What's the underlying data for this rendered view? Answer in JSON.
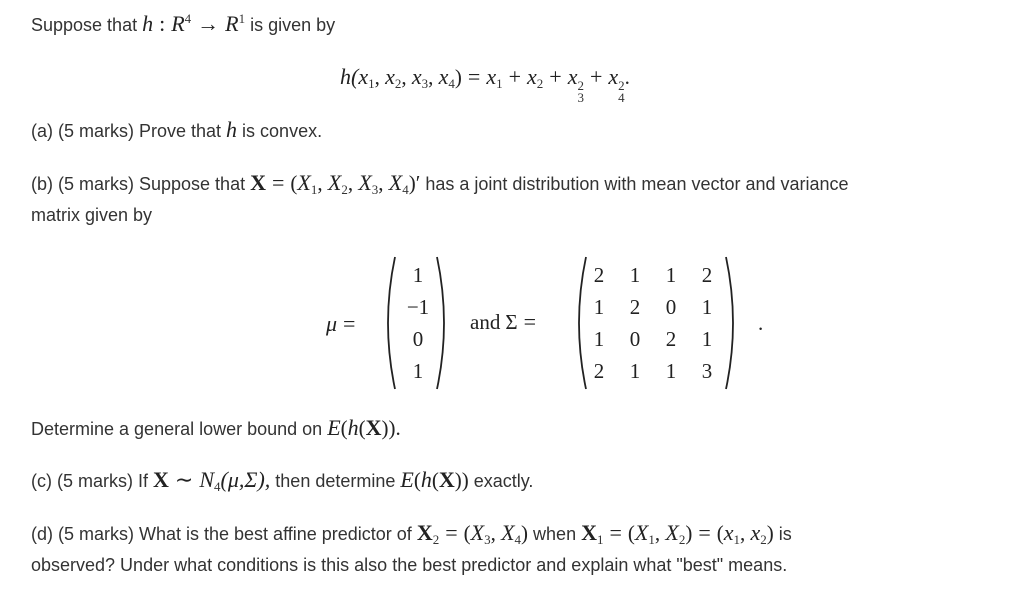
{
  "intro": {
    "text_before": "Suppose that ",
    "func": "h",
    "colon": ":",
    "domain": "R",
    "domain_exp": "4",
    "arrow": "→",
    "codomain": "R",
    "codomain_exp": "1",
    "text_after": " is given by"
  },
  "definition": {
    "lhs": "h(",
    "args": [
      "x",
      "x",
      "x",
      "x"
    ],
    "arg_subs": [
      "1",
      "2",
      "3",
      "4"
    ],
    "equals": "=",
    "rhs_terms": [
      {
        "var": "x",
        "sub": "1",
        "sup": ""
      },
      {
        "var": "x",
        "sub": "2",
        "sup": ""
      },
      {
        "var": "x",
        "sub": "3",
        "sup": "2"
      },
      {
        "var": "x",
        "sub": "4",
        "sup": "2"
      }
    ],
    "plus": "+",
    "end": "."
  },
  "part_a": {
    "label": "(a) (5 marks) Prove that ",
    "func": "h",
    "text_after": " is convex."
  },
  "part_b": {
    "label": "(b) (5 marks) Suppose that ",
    "vec": "X",
    "equals": "=",
    "tuple_vars": [
      "X",
      "X",
      "X",
      "X"
    ],
    "tuple_subs": [
      "1",
      "2",
      "3",
      "4"
    ],
    "transpose": "′",
    "text_after": " has a joint distribution with mean vector and variance",
    "line2": "matrix given by",
    "mu_symbol": "μ",
    "and_text": "and",
    "sigma_symbol": "Σ",
    "mu_values": [
      "1",
      "−1",
      "0",
      "1"
    ],
    "sigma_values": [
      [
        "2",
        "1",
        "1",
        "2"
      ],
      [
        "1",
        "2",
        "0",
        "1"
      ],
      [
        "1",
        "0",
        "2",
        "1"
      ],
      [
        "2",
        "1",
        "1",
        "3"
      ]
    ],
    "end": ".",
    "question_text": "Determine a general lower bound on ",
    "question_expr": "E(h(X)).",
    "expectation": "E",
    "func": "h"
  },
  "part_c": {
    "label": "(c) (5 marks) If ",
    "vec": "X",
    "dist_symbol": "∼",
    "dist": "N",
    "dist_sub": "4",
    "params": "(μ,Σ),",
    "text_mid": " then determine ",
    "expectation": "E",
    "func": "h",
    "text_after": " exactly."
  },
  "part_d": {
    "label": "(d) (5 marks) What is the best affine predictor of ",
    "vec": "X",
    "vec2_sub": "2",
    "vec1_sub": "1",
    "tuple1": [
      "X",
      "X"
    ],
    "tuple1_subs": [
      "3",
      "4"
    ],
    "text_when": " when ",
    "tuple2": [
      "X",
      "X"
    ],
    "tuple2_subs": [
      "1",
      "2"
    ],
    "tuple3": [
      "x",
      "x"
    ],
    "tuple3_subs": [
      "1",
      "2"
    ],
    "text_is": " is",
    "line2": "observed? Under what conditions is this also the best predictor and explain what \"best\" means."
  }
}
